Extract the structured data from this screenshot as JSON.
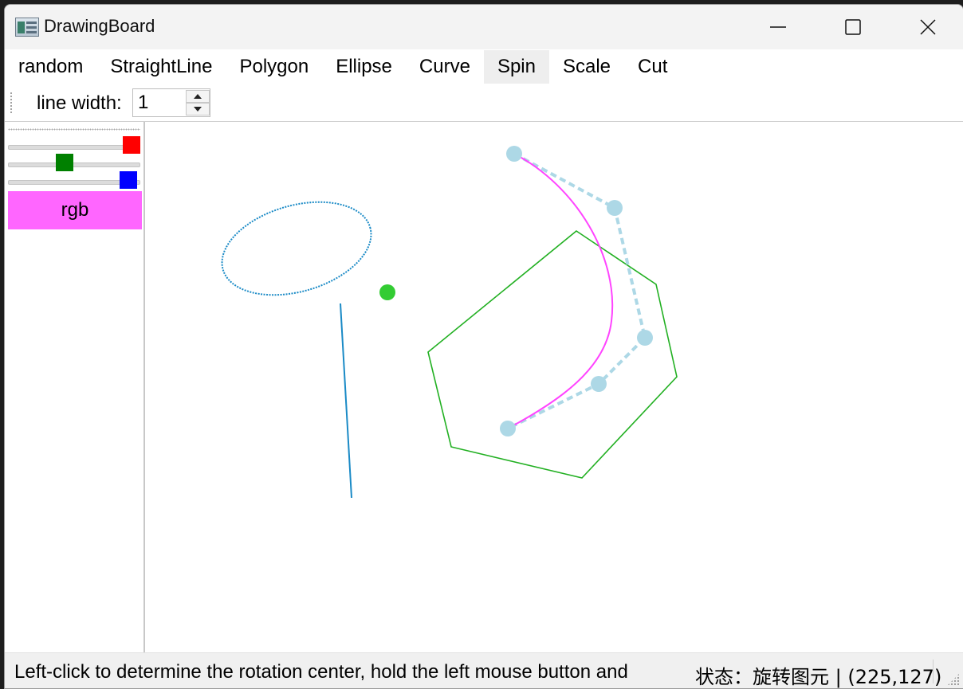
{
  "window": {
    "title": "DrawingBoard",
    "icons": {
      "app": "app-icon",
      "minimize": "minimize-icon",
      "maximize": "maximize-icon",
      "close": "close-icon"
    }
  },
  "menu": {
    "items": [
      {
        "label": "random",
        "active": false
      },
      {
        "label": "StraightLine",
        "active": false
      },
      {
        "label": "Polygon",
        "active": false
      },
      {
        "label": "Ellipse",
        "active": false
      },
      {
        "label": "Curve",
        "active": false
      },
      {
        "label": "Spin",
        "active": true
      },
      {
        "label": "Scale",
        "active": false
      },
      {
        "label": "Cut",
        "active": false
      }
    ]
  },
  "toolbar": {
    "line_width_label": "line width:",
    "line_width_value": "1"
  },
  "color_panel": {
    "sliders": [
      {
        "name": "red",
        "color": "#ff0000",
        "level": 1.0
      },
      {
        "name": "green",
        "color": "#008000",
        "level": 0.42
      },
      {
        "name": "blue",
        "color": "#0000ff",
        "level": 0.97
      }
    ],
    "swatch_label": "rgb",
    "swatch_color": "#ff66ff"
  },
  "canvas_colors": {
    "ellipse_line": "#1a8ac6",
    "polygon": "#22b022",
    "curve": "#ff44ff",
    "control_points": "#add8e6",
    "rotation_center": "#33cc33"
  },
  "status": {
    "message": "Left-click to determine the rotation center, hold the left mouse button and",
    "state": "状态：旋转图元 | (225,127)"
  }
}
